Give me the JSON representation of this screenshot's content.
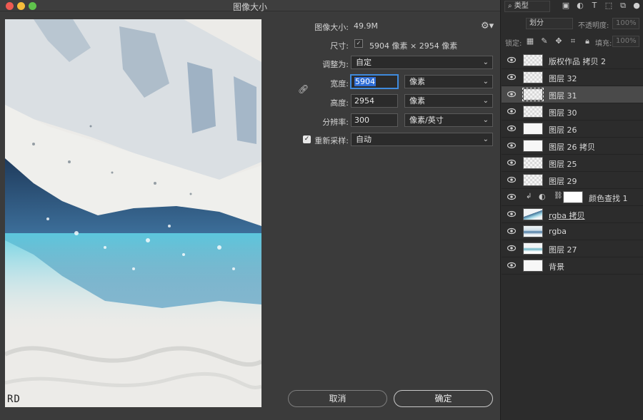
{
  "dialog": {
    "title": "图像大小",
    "image_size_label": "图像大小:",
    "image_size_value": "49.9M",
    "dimensions_label": "尺寸:",
    "dimensions_value": "5904 像素  ×  2954 像素",
    "fit_to_label": "调整为:",
    "fit_to_value": "自定",
    "width_label": "宽度:",
    "width_value": "5904",
    "width_unit": "像素",
    "height_label": "高度:",
    "height_value": "2954",
    "height_unit": "像素",
    "resolution_label": "分辨率:",
    "resolution_value": "300",
    "resolution_unit": "像素/英寸",
    "resample_label": "重新采样:",
    "resample_checked": true,
    "resample_value": "自动",
    "cancel_label": "取消",
    "ok_label": "确定",
    "preview_watermark": "RD"
  },
  "panel": {
    "filter_type": "类型",
    "blend_mode": "划分",
    "opacity_label": "不透明度:",
    "opacity_value": "100%",
    "lock_label": "锁定:",
    "fill_label": "填充:",
    "fill_value": "100%",
    "layers": [
      {
        "name": "版权作品 拷贝 2",
        "thumb": "checker"
      },
      {
        "name": "图层 32",
        "thumb": "checker"
      },
      {
        "name": "图层 31",
        "thumb": "checker",
        "active": true
      },
      {
        "name": "图层 30",
        "thumb": "checker"
      },
      {
        "name": "图层 26",
        "thumb": "checker"
      },
      {
        "name": "图层 26 拷贝",
        "thumb": "checker"
      },
      {
        "name": "图层 25",
        "thumb": "checker"
      },
      {
        "name": "图层 29",
        "thumb": "checker"
      },
      {
        "name": "颜色查找 1",
        "thumb": "adjustment"
      },
      {
        "name": "rgba 拷贝",
        "thumb": "pic"
      },
      {
        "name": "rgba",
        "thumb": "pic2"
      },
      {
        "name": "图层 27",
        "thumb": "pic3"
      },
      {
        "name": "背景",
        "thumb": "white"
      }
    ]
  }
}
